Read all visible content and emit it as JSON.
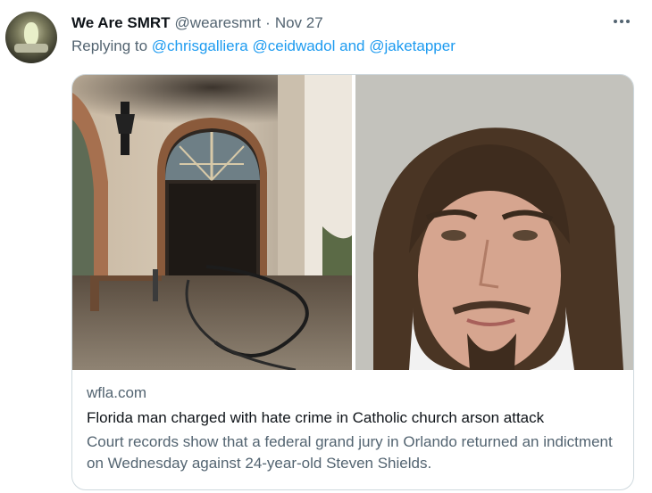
{
  "tweet": {
    "display_name": "We Are SMRT",
    "handle": "@wearesmrt",
    "separator": "·",
    "date": "Nov 27",
    "more_icon": "more-horizontal-icon",
    "replying_prefix": "Replying to",
    "mentions": [
      "@chrisgalliera",
      "@ceidwadol"
    ],
    "and_word": "and",
    "last_mention": "@jaketapper"
  },
  "card": {
    "domain": "wfla.com",
    "title": "Florida man charged with hate crime in Catholic church arson attack",
    "description": "Court records show that a federal grand jury in Orlando returned an indictment on Wednesday against 24-year-old Steven Shields."
  },
  "colors": {
    "text_primary": "#0f1419",
    "text_secondary": "#536471",
    "link": "#1d9bf0",
    "border": "#cfd9de"
  }
}
